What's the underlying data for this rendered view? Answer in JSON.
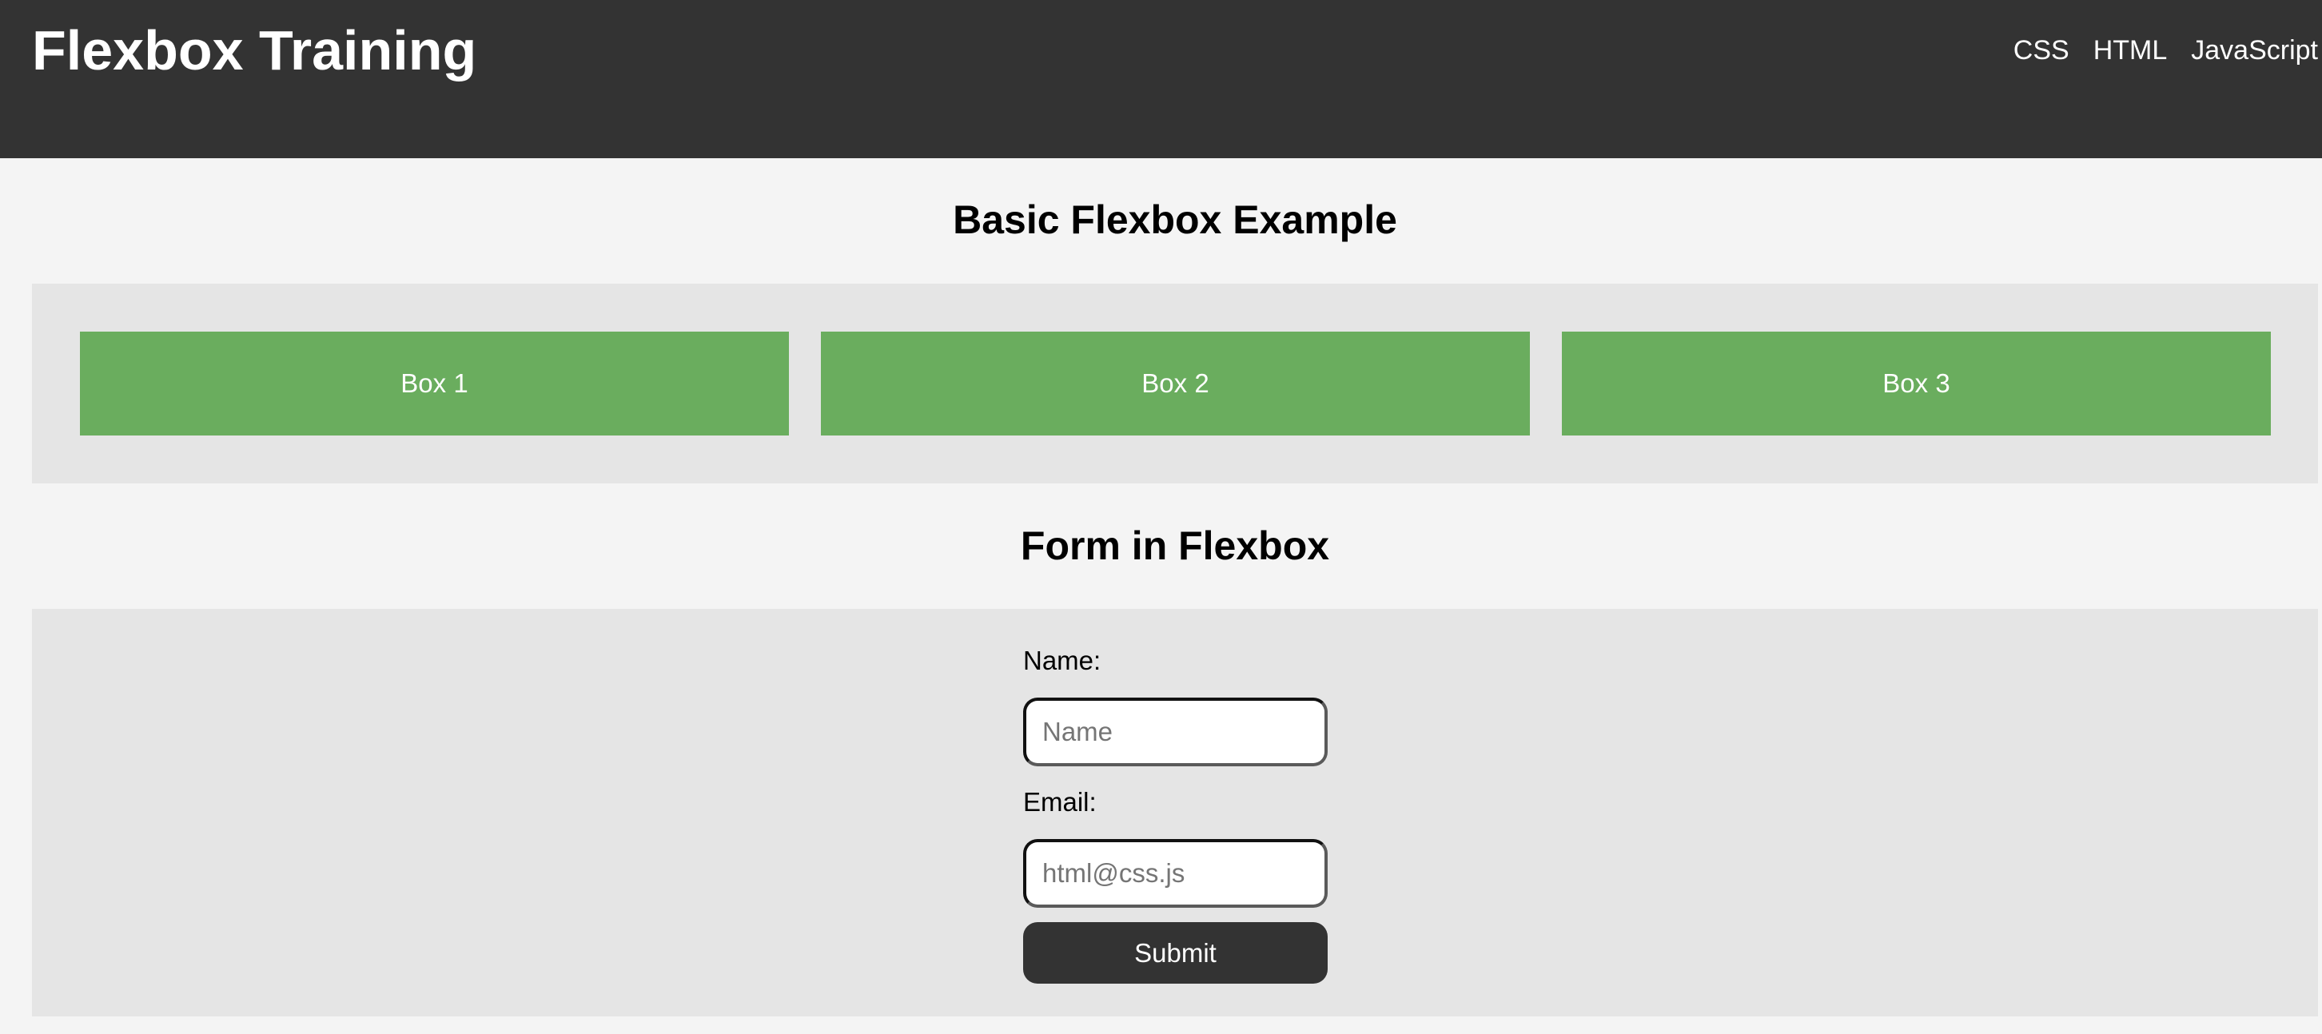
{
  "header": {
    "title": "Flexbox Training",
    "nav": [
      "CSS",
      "HTML",
      "JavaScript"
    ]
  },
  "basic_section": {
    "title": "Basic Flexbox Example",
    "boxes": [
      "Box 1",
      "Box 2",
      "Box 3"
    ]
  },
  "form_section": {
    "title": "Form in Flexbox",
    "name_label": "Name:",
    "name_placeholder": "Name",
    "name_value": "",
    "email_label": "Email:",
    "email_placeholder": "html@css.js",
    "email_value": "",
    "submit_label": "Submit"
  },
  "colors": {
    "header_bg": "#333333",
    "page_bg": "#f4f4f4",
    "panel_bg": "#e5e5e5",
    "box_green": "#6aad5e",
    "button_bg": "#333333"
  }
}
